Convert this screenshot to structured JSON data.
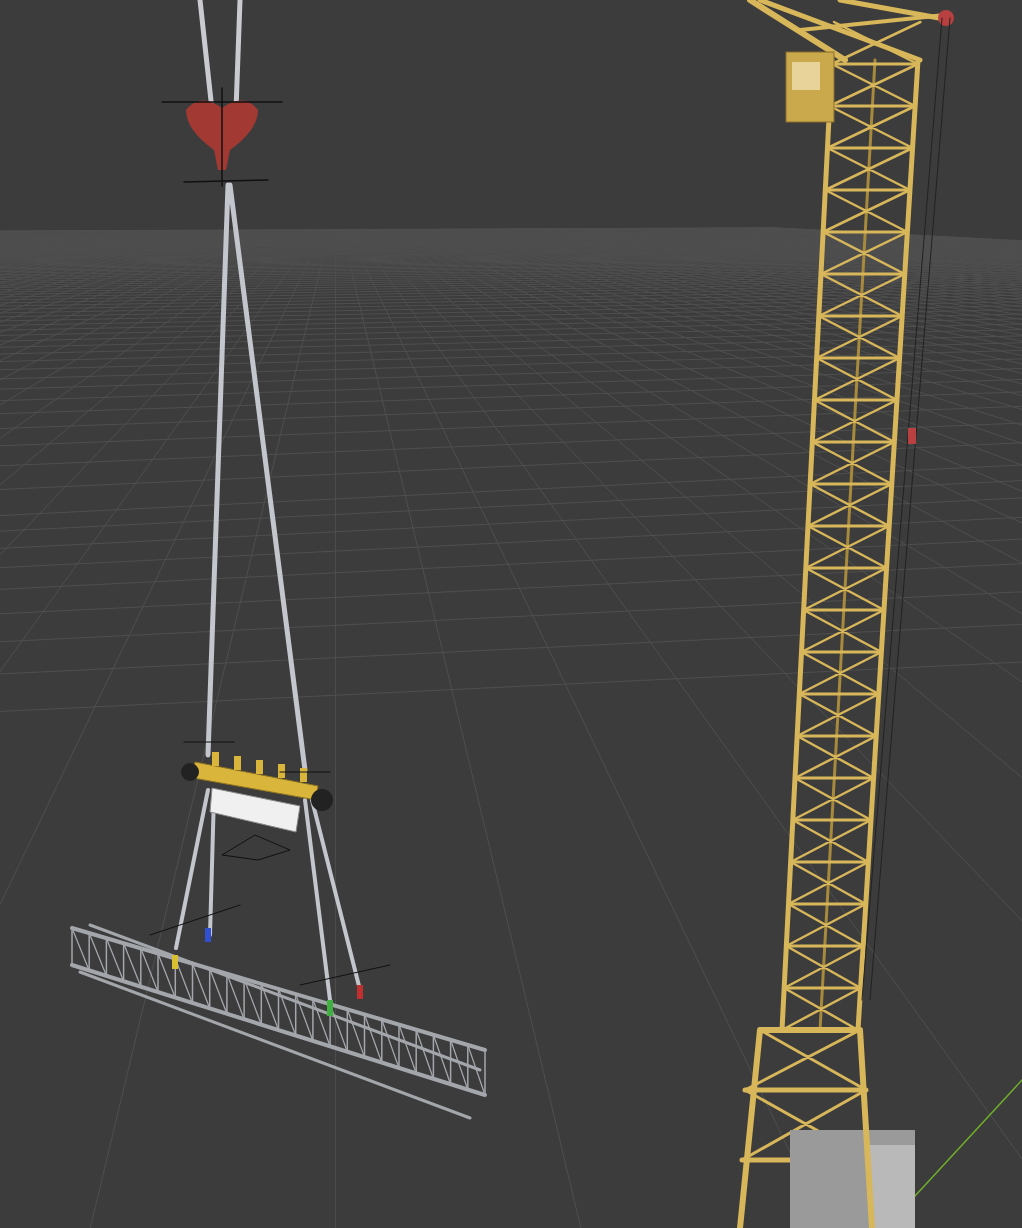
{
  "viewport": {
    "kind": "scene"
  }
}
